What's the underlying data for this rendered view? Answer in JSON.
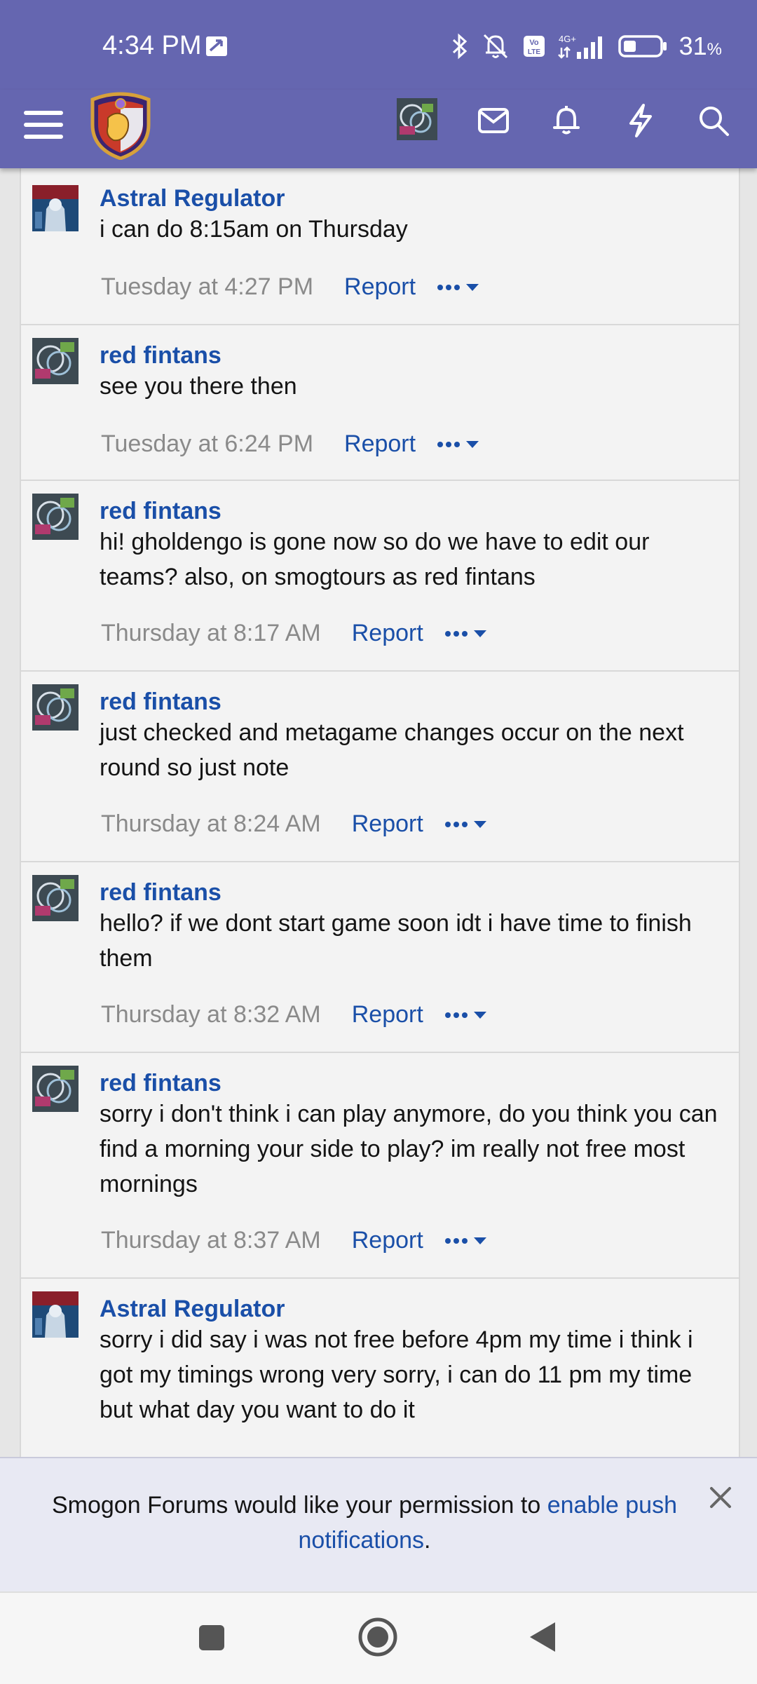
{
  "status_bar": {
    "time": "4:34 PM",
    "network": "4G+",
    "battery": "31",
    "battery_unit": "%"
  },
  "app_header": {
    "icons": [
      "menu-icon",
      "site-logo",
      "user-avatar",
      "mail-icon",
      "bell-icon",
      "lightning-icon",
      "search-icon"
    ]
  },
  "posts": [
    {
      "author": "Astral Regulator",
      "avatar": "astral",
      "message": "i can do 8:15am on Thursday",
      "time": "Tuesday at 4:27 PM",
      "report": "Report"
    },
    {
      "author": "red fintans",
      "avatar": "red",
      "message": "see you there then",
      "time": "Tuesday at 6:24 PM",
      "report": "Report"
    },
    {
      "author": "red fintans",
      "avatar": "red",
      "message": "hi! gholdengo is gone now so do we have to edit our teams? also, on smogtours as red fintans",
      "time": "Thursday at 8:17 AM",
      "report": "Report"
    },
    {
      "author": "red fintans",
      "avatar": "red",
      "message": "just checked and metagame changes occur on the next round so just note",
      "time": "Thursday at 8:24 AM",
      "report": "Report"
    },
    {
      "author": "red fintans",
      "avatar": "red",
      "message": "hello? if we dont start game soon idt i have time to finish them",
      "time": "Thursday at 8:32 AM",
      "report": "Report"
    },
    {
      "author": "red fintans",
      "avatar": "red",
      "message": "sorry i don't think i can play anymore, do you think you can find a morning your side to play? im really not free most mornings",
      "time": "Thursday at 8:37 AM",
      "report": "Report"
    },
    {
      "author": "Astral Regulator",
      "avatar": "astral",
      "message": "sorry i did say i was not free before 4pm my time i think i got my timings wrong very sorry, i can do 11 pm my time but what day you want to do it",
      "time": "",
      "report": ""
    }
  ],
  "push_notice": {
    "text_before": "Smogon Forums would like your permission to ",
    "link": "enable push notifications",
    "text_after": "."
  },
  "colors": {
    "header": "#6566b0",
    "link": "#1a4fa8",
    "timestamp": "#8a8a8a",
    "post_bg": "#f3f3f3"
  }
}
